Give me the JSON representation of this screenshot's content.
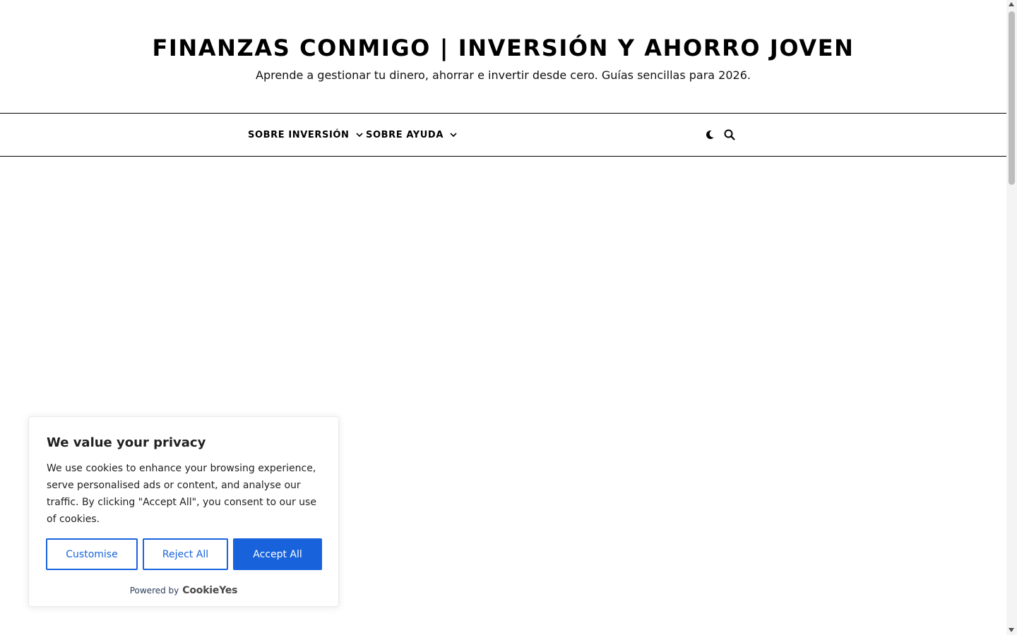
{
  "header": {
    "site_title": "FINANZAS CONMIGO | INVERSIÓN Y AHORRO JOVEN",
    "tagline": "Aprende a gestionar tu dinero, ahorrar e invertir desde cero. Guías sencillas para 2026."
  },
  "nav": {
    "items": [
      {
        "label": "SOBRE INVERSIÓN",
        "icon": "chevron-down-icon"
      },
      {
        "label": "SOBRE AYUDA",
        "icon": "chevron-down-icon"
      }
    ],
    "dark_mode_icon": "moon-icon",
    "search_icon": "search-icon"
  },
  "cookie_banner": {
    "title": "We value your privacy",
    "text": "We use cookies to enhance your browsing experience, serve personalised ads or content, and analyse our traffic. By clicking \"Accept All\", you consent to our use of cookies.",
    "customise_label": "Customise",
    "reject_label": "Reject All",
    "accept_label": "Accept All",
    "powered_by": "Powered by",
    "brand": "CookieYes",
    "accent_color": "#1863dc"
  }
}
